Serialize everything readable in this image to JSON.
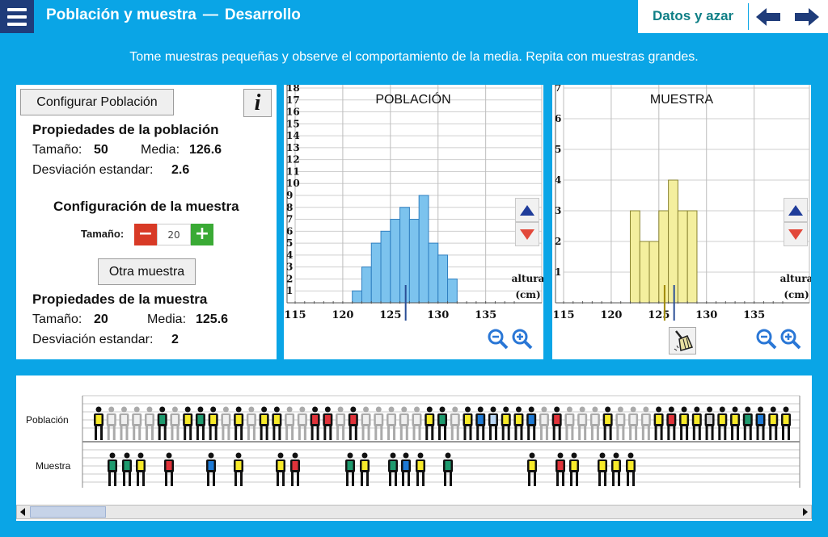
{
  "header": {
    "title": "Población y muestra",
    "separator": "—",
    "subtitle": "Desarrollo",
    "chapter": "Datos y azar"
  },
  "instruction": "Tome muestras pequeñas y observe el comportamiento de la media. Repita con muestras grandes.",
  "left_panel": {
    "config_button": "Configurar Población",
    "info_button": "i",
    "population_heading": "Propiedades de la población",
    "size_label": "Tamaño:",
    "population_size": "50",
    "mean_label": "Media:",
    "population_mean": "126.6",
    "sd_label": "Desviación estandar:",
    "population_sd": "2.6",
    "sample_config_heading": "Configuración de la muestra",
    "stepper_label": "Tamaño:",
    "stepper_minus": "−",
    "stepper_value": "20",
    "stepper_plus": "+",
    "other_sample_button": "Otra muestra",
    "sample_heading": "Propiedades de la muestra",
    "sample_size": "20",
    "sample_mean": "125.6",
    "sample_sd": "2"
  },
  "chart_data": [
    {
      "type": "bar",
      "title": "POBLACIÓN",
      "xlabel": "altura (cm)",
      "ylabel": "",
      "xlim": [
        115,
        138
      ],
      "ylim": [
        0,
        18
      ],
      "x_ticks": [
        115,
        120,
        125,
        130,
        135
      ],
      "y_ticks": [
        1,
        2,
        3,
        4,
        5,
        6,
        7,
        8,
        9,
        10,
        11,
        12,
        13,
        14,
        15,
        16,
        17,
        18
      ],
      "bin_width": 1,
      "bins": [
        121,
        122,
        123,
        124,
        125,
        126,
        127,
        128,
        129,
        130,
        131
      ],
      "values": [
        1,
        3,
        5,
        6,
        7,
        8,
        7,
        9,
        5,
        4,
        2
      ],
      "mean": 126.6,
      "color": "#7cc3ee",
      "edge_color": "#2f7fc0",
      "mean_color": "#2a4e96"
    },
    {
      "type": "bar",
      "title": "MUESTRA",
      "xlabel": "altura (cm)",
      "ylabel": "",
      "xlim": [
        115,
        138
      ],
      "ylim": [
        0,
        7
      ],
      "x_ticks": [
        115,
        120,
        125,
        130,
        135
      ],
      "y_ticks": [
        1,
        2,
        3,
        4,
        5,
        6,
        7
      ],
      "bin_width": 1,
      "bins": [
        122,
        123,
        124,
        125,
        126,
        127,
        128
      ],
      "values": [
        3,
        2,
        2,
        3,
        4,
        3,
        3
      ],
      "mean": 125.6,
      "population_mean": 126.6,
      "color": "#f4ef9e",
      "edge_color": "#8a8432",
      "mean_color": "#a08a00",
      "population_mean_color": "#2a4e96"
    }
  ],
  "people": {
    "population_label": "Población",
    "sample_label": "Muestra",
    "population_colors": [
      "#f7ea2a",
      "#d0d0d0",
      "#d0d0d0",
      "#c8e6c0",
      "#f7ea2a",
      "#1e9a6e",
      "#f4c0c8",
      "#f7ea2a",
      "#1e9a6e",
      "#f7ea2a",
      "#bcd8f5",
      "#f7ea2a",
      "#d0d0d0",
      "#f7ea2a",
      "#f7ea2a",
      "#d0d0d0",
      "#d0d0d0",
      "#e0333a",
      "#e0333a",
      "#d0d0d0",
      "#e0333a",
      "#d0d0d0",
      "#bcd8f5",
      "#c8e6c0",
      "#d0d0d0",
      "#d0d0d0",
      "#f7ea2a",
      "#1e9a6e",
      "#d0d0d0",
      "#f7ea2a",
      "#1e7ad5",
      "#bcd8f5",
      "#f7ea2a",
      "#f7ea2a",
      "#1e7ad5",
      "#d0d0d0",
      "#e0333a",
      "#d0d0d0",
      "#f7ea2a",
      "#d0d0d0",
      "#f7ea2a",
      "#d0d0d0",
      "#f7ea2a",
      "#d0d0d0",
      "#f7ea2a",
      "#e0333a",
      "#f7ea2a",
      "#f7ea2a",
      "#d0d0d0",
      "#f7ea2a",
      "#f7ea2a",
      "#1e9a6e",
      "#1e7ad5",
      "#f7ea2a",
      "#f7ea2a"
    ],
    "population_dim": [
      false,
      true,
      true,
      true,
      true,
      false,
      true,
      false,
      false,
      false,
      true,
      false,
      true,
      false,
      false,
      true,
      true,
      false,
      false,
      true,
      false,
      true,
      true,
      true,
      true,
      true,
      false,
      false,
      true,
      false,
      false,
      false,
      false,
      false,
      false,
      true,
      false,
      true,
      true,
      true,
      false,
      true,
      true,
      true,
      false,
      false,
      false,
      false,
      false,
      false,
      false,
      false,
      false,
      false,
      false
    ],
    "sample_colors": [
      "#1e9a6e",
      "#1e9a6e",
      "#f7ea2a",
      "#e0333a",
      "#1e7ad5",
      "#f7ea2a",
      "#f7ea2a",
      "#e0333a",
      "#1e9a6e",
      "#f7ea2a",
      "#1e9a6e",
      "#1e7ad5",
      "#f7ea2a",
      "#1e9a6e",
      "#f7ea2a",
      "#e0333a",
      "#f7ea2a",
      "#f7ea2a",
      "#f7ea2a",
      "#f7ea2a"
    ]
  }
}
